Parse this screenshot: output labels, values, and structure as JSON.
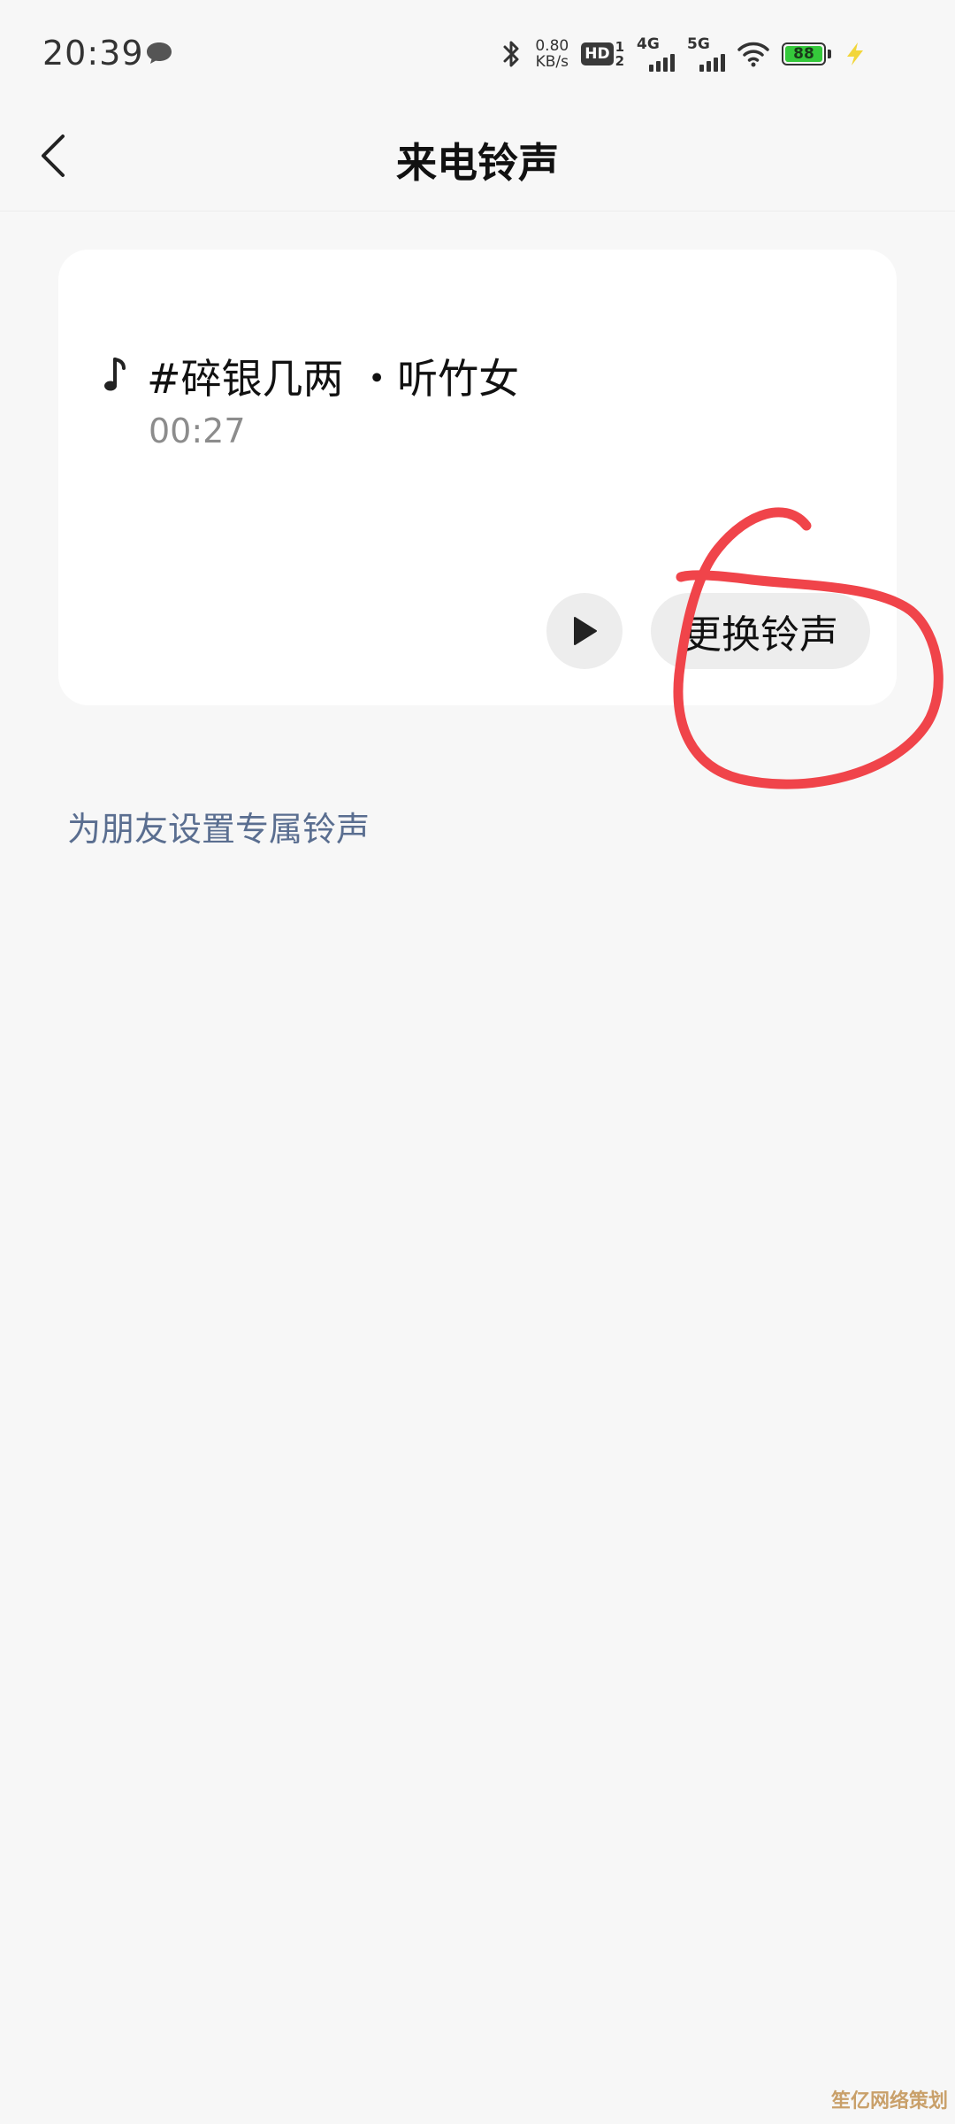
{
  "status_bar": {
    "time": "20:39",
    "net_speed_value": "0.80",
    "net_speed_unit": "KB/s",
    "hd_label": "HD",
    "hd_sim_top": "1",
    "hd_sim_bottom": "2",
    "network_1": "4G",
    "network_2": "5G",
    "battery_level": "88",
    "battery_color": "#35c93b",
    "icons": [
      "message-icon",
      "bluetooth-icon",
      "wifi-icon",
      "battery-icon",
      "charging-icon"
    ]
  },
  "header": {
    "title": "来电铃声",
    "back_icon": "chevron-left-icon"
  },
  "ringtone": {
    "title": "#碎银几两 ・听竹女",
    "duration": "00:27",
    "play_icon": "play-icon",
    "change_label": "更换铃声"
  },
  "friend_link": {
    "label": "为朋友设置专属铃声",
    "color": "#5a6e90"
  },
  "annotation": {
    "color": "#f0444a"
  },
  "watermark": {
    "text": "笙亿网络策划"
  }
}
